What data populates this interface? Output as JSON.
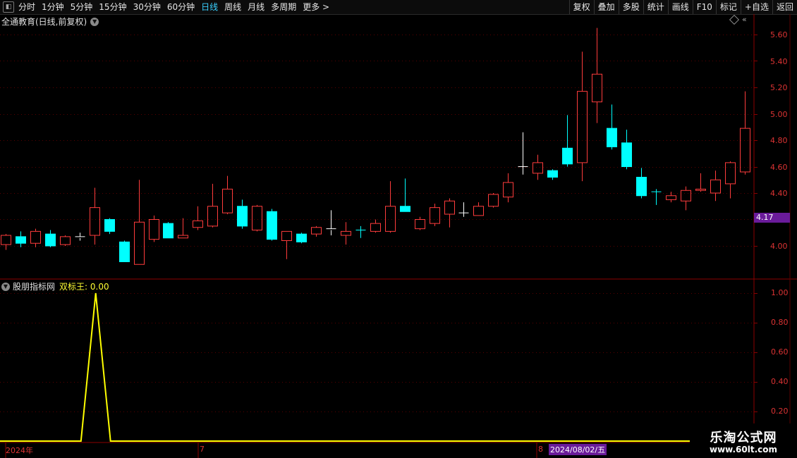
{
  "toolbar": {
    "periods": [
      "分时",
      "1分钟",
      "5分钟",
      "15分钟",
      "30分钟",
      "60分钟",
      "日线",
      "周线",
      "月线",
      "多周期",
      "更多 >"
    ],
    "active_period": "日线",
    "buttons": [
      "复权",
      "叠加",
      "多股",
      "统计",
      "画线",
      "F10",
      "标记",
      "+自选",
      "返回"
    ]
  },
  "main_chart": {
    "title": "全通教育(日线,前复权)",
    "price_ticks": [
      "5.60",
      "5.40",
      "5.20",
      "5.00",
      "4.80",
      "4.60",
      "4.40",
      "4.20",
      "4.00"
    ],
    "current_price_label": "4.17"
  },
  "indicator": {
    "name": "股朋指标网",
    "value_label": "双标王: 0.00",
    "ticks": [
      "1.00",
      "0.80",
      "0.60",
      "0.40",
      "0.20"
    ]
  },
  "date_axis": {
    "labels": [
      "2024年",
      "7",
      "8"
    ],
    "cursor_date": "2024/08/02/五"
  },
  "watermark": {
    "title": "乐淘公式网",
    "url": "www.60lt.com"
  },
  "colors": {
    "up": "#ff3c3c",
    "down": "#00ffff",
    "doji": "#ffffff",
    "indicator": "#ffff00",
    "grid": "#8b0000",
    "price_tag_bg": "#6a1b9a"
  },
  "chart_data": {
    "type": "candlestick",
    "title": "全通教育(日线,前复权)",
    "yrange": [
      3.84,
      5.7
    ],
    "candles": [
      {
        "o": 4.01,
        "c": 4.08,
        "h": 4.09,
        "l": 3.97,
        "dir": "up"
      },
      {
        "o": 4.07,
        "c": 4.02,
        "h": 4.11,
        "l": 3.99,
        "dir": "down"
      },
      {
        "o": 4.02,
        "c": 4.11,
        "h": 4.13,
        "l": 3.99,
        "dir": "up"
      },
      {
        "o": 4.09,
        "c": 4.0,
        "h": 4.12,
        "l": 3.99,
        "dir": "down"
      },
      {
        "o": 4.01,
        "c": 4.07,
        "h": 4.08,
        "l": 4.0,
        "dir": "up"
      },
      {
        "o": 4.06,
        "c": 4.07,
        "h": 4.1,
        "l": 4.04,
        "dir": "doji"
      },
      {
        "o": 4.08,
        "c": 4.29,
        "h": 4.44,
        "l": 4.01,
        "dir": "up"
      },
      {
        "o": 4.2,
        "c": 4.11,
        "h": 4.21,
        "l": 4.09,
        "dir": "down"
      },
      {
        "o": 4.03,
        "c": 3.88,
        "h": 4.04,
        "l": 3.88,
        "dir": "down"
      },
      {
        "o": 3.86,
        "c": 4.18,
        "h": 4.5,
        "l": 3.86,
        "dir": "up"
      },
      {
        "o": 4.05,
        "c": 4.2,
        "h": 4.23,
        "l": 4.03,
        "dir": "up"
      },
      {
        "o": 4.17,
        "c": 4.06,
        "h": 4.18,
        "l": 4.06,
        "dir": "down"
      },
      {
        "o": 4.06,
        "c": 4.08,
        "h": 4.21,
        "l": 4.06,
        "dir": "up"
      },
      {
        "o": 4.14,
        "c": 4.19,
        "h": 4.3,
        "l": 4.12,
        "dir": "up"
      },
      {
        "o": 4.15,
        "c": 4.3,
        "h": 4.47,
        "l": 4.14,
        "dir": "up"
      },
      {
        "o": 4.25,
        "c": 4.43,
        "h": 4.53,
        "l": 4.24,
        "dir": "up"
      },
      {
        "o": 4.3,
        "c": 4.15,
        "h": 4.35,
        "l": 4.13,
        "dir": "down"
      },
      {
        "o": 4.12,
        "c": 4.3,
        "h": 4.31,
        "l": 4.11,
        "dir": "up"
      },
      {
        "o": 4.26,
        "c": 4.05,
        "h": 4.28,
        "l": 4.04,
        "dir": "down"
      },
      {
        "o": 4.04,
        "c": 4.11,
        "h": 4.11,
        "l": 3.9,
        "dir": "up"
      },
      {
        "o": 4.09,
        "c": 4.03,
        "h": 4.1,
        "l": 4.02,
        "dir": "down"
      },
      {
        "o": 4.09,
        "c": 4.14,
        "h": 4.15,
        "l": 4.07,
        "dir": "up"
      },
      {
        "o": 4.12,
        "c": 4.13,
        "h": 4.27,
        "l": 4.08,
        "dir": "doji"
      },
      {
        "o": 4.08,
        "c": 4.11,
        "h": 4.18,
        "l": 4.01,
        "dir": "up"
      },
      {
        "o": 4.12,
        "c": 4.12,
        "h": 4.15,
        "l": 4.06,
        "dir": "doji_down"
      },
      {
        "o": 4.11,
        "c": 4.17,
        "h": 4.2,
        "l": 4.1,
        "dir": "up"
      },
      {
        "o": 4.11,
        "c": 4.3,
        "h": 4.49,
        "l": 4.1,
        "dir": "up"
      },
      {
        "o": 4.3,
        "c": 4.26,
        "h": 4.51,
        "l": 4.26,
        "dir": "down"
      },
      {
        "o": 4.13,
        "c": 4.2,
        "h": 4.22,
        "l": 4.12,
        "dir": "up"
      },
      {
        "o": 4.17,
        "c": 4.29,
        "h": 4.32,
        "l": 4.15,
        "dir": "up"
      },
      {
        "o": 4.24,
        "c": 4.34,
        "h": 4.36,
        "l": 4.14,
        "dir": "up"
      },
      {
        "o": 4.25,
        "c": 4.25,
        "h": 4.33,
        "l": 4.22,
        "dir": "doji"
      },
      {
        "o": 4.23,
        "c": 4.3,
        "h": 4.33,
        "l": 4.23,
        "dir": "up"
      },
      {
        "o": 4.3,
        "c": 4.39,
        "h": 4.4,
        "l": 4.29,
        "dir": "up"
      },
      {
        "o": 4.37,
        "c": 4.48,
        "h": 4.55,
        "l": 4.33,
        "dir": "up"
      },
      {
        "o": 4.6,
        "c": 4.6,
        "h": 4.86,
        "l": 4.54,
        "dir": "doji"
      },
      {
        "o": 4.55,
        "c": 4.63,
        "h": 4.69,
        "l": 4.5,
        "dir": "up"
      },
      {
        "o": 4.57,
        "c": 4.52,
        "h": 4.58,
        "l": 4.5,
        "dir": "down"
      },
      {
        "o": 4.74,
        "c": 4.62,
        "h": 4.99,
        "l": 4.6,
        "dir": "down"
      },
      {
        "o": 4.63,
        "c": 5.17,
        "h": 5.47,
        "l": 4.49,
        "dir": "up"
      },
      {
        "o": 5.09,
        "c": 5.3,
        "h": 5.65,
        "l": 4.93,
        "dir": "up"
      },
      {
        "o": 4.89,
        "c": 4.75,
        "h": 5.07,
        "l": 4.73,
        "dir": "down"
      },
      {
        "o": 4.78,
        "c": 4.6,
        "h": 4.88,
        "l": 4.58,
        "dir": "down"
      },
      {
        "o": 4.52,
        "c": 4.38,
        "h": 4.59,
        "l": 4.36,
        "dir": "down"
      },
      {
        "o": 4.41,
        "c": 4.41,
        "h": 4.43,
        "l": 4.31,
        "dir": "doji_down"
      },
      {
        "o": 4.35,
        "c": 4.38,
        "h": 4.41,
        "l": 4.33,
        "dir": "up"
      },
      {
        "o": 4.34,
        "c": 4.42,
        "h": 4.45,
        "l": 4.27,
        "dir": "up"
      },
      {
        "o": 4.42,
        "c": 4.43,
        "h": 4.55,
        "l": 4.41,
        "dir": "up"
      },
      {
        "o": 4.4,
        "c": 4.5,
        "h": 4.57,
        "l": 4.34,
        "dir": "up"
      },
      {
        "o": 4.47,
        "c": 4.63,
        "h": 4.64,
        "l": 4.36,
        "dir": "up"
      },
      {
        "o": 4.56,
        "c": 4.89,
        "h": 5.17,
        "l": 4.54,
        "dir": "up"
      }
    ],
    "indicator_series": {
      "name": "双标王",
      "yrange": [
        0,
        1.05
      ],
      "values": [
        0,
        0,
        0,
        0,
        0,
        0,
        1,
        0,
        0,
        0,
        0,
        0,
        0,
        0,
        0,
        0,
        0,
        0,
        0,
        0,
        0,
        0,
        0,
        0,
        0,
        0,
        0,
        0,
        0,
        0,
        0,
        0,
        0,
        0,
        0,
        0,
        0,
        0,
        0,
        0,
        0,
        0,
        0,
        0,
        0,
        0,
        0,
        0,
        0,
        0,
        0
      ]
    }
  }
}
